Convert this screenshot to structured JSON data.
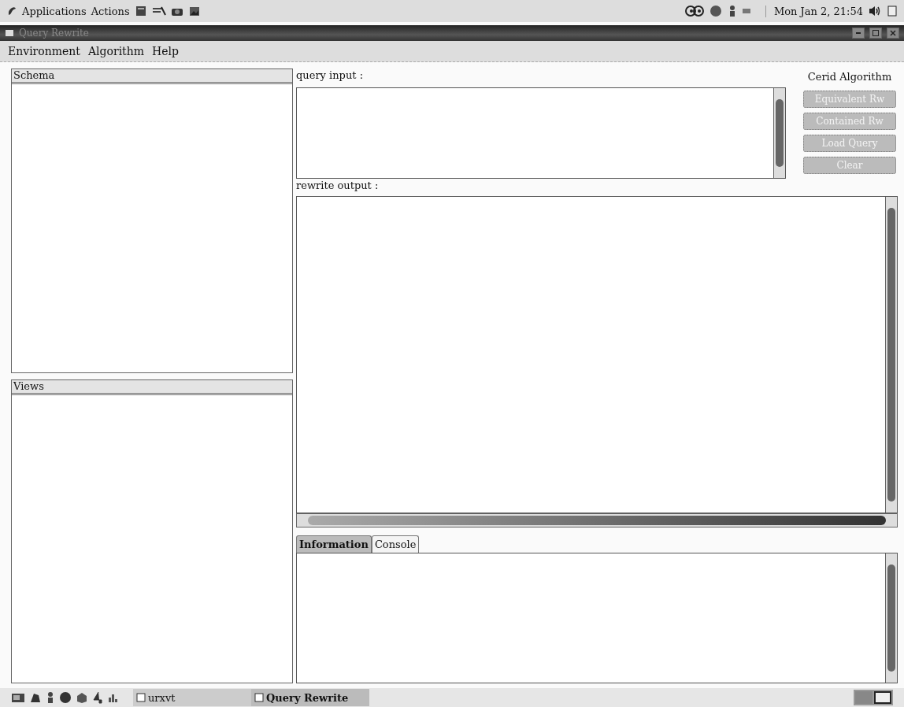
{
  "top_panel": {
    "menus": [
      "Applications",
      "Actions"
    ],
    "clock": "Mon Jan  2, 21:54"
  },
  "window": {
    "title": "Query Rewrite"
  },
  "menu_bar": [
    "Environment",
    "Algorithm",
    "Help"
  ],
  "schema_panel": {
    "title": "Schema"
  },
  "views_panel": {
    "title": "Views"
  },
  "query_input": {
    "label": "query input :"
  },
  "algorithm": {
    "title": "Cerid Algorithm",
    "buttons": [
      {
        "label": "Equivalent Rw",
        "disabled": true
      },
      {
        "label": "Contained Rw",
        "disabled": true
      },
      {
        "label": "Load Query",
        "disabled": true
      },
      {
        "label": "Clear",
        "disabled": true
      }
    ]
  },
  "rewrite_output": {
    "label": "rewrite output :"
  },
  "tabs": [
    {
      "label": "Information",
      "selected": true
    },
    {
      "label": "Console",
      "selected": false
    }
  ],
  "taskbar": {
    "tasks": [
      {
        "label": "urxvt",
        "selected": false
      },
      {
        "label": "Query Rewrite",
        "selected": true
      }
    ]
  }
}
